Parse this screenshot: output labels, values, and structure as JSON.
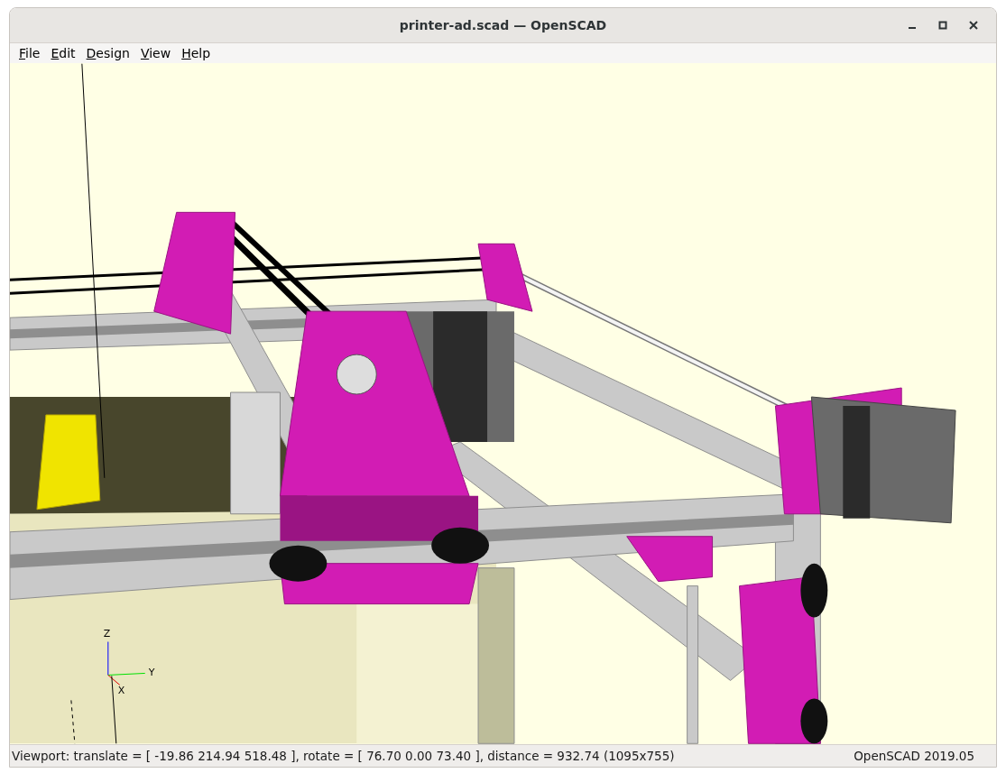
{
  "window": {
    "title": "printer-ad.scad — OpenSCAD"
  },
  "menu": [
    "File",
    "Edit",
    "Design",
    "View",
    "Help"
  ],
  "viewport": {
    "axis_labels": {
      "z": "Z",
      "y": "Y",
      "x": "X"
    }
  },
  "status_bar": {
    "viewport": "Viewport: translate = [ -19.86 214.94 518.48 ], rotate = [ 76.70 0.00 73.40 ], distance = 932.74 (1095x755)",
    "version": "OpenSCAD 2019.05"
  }
}
